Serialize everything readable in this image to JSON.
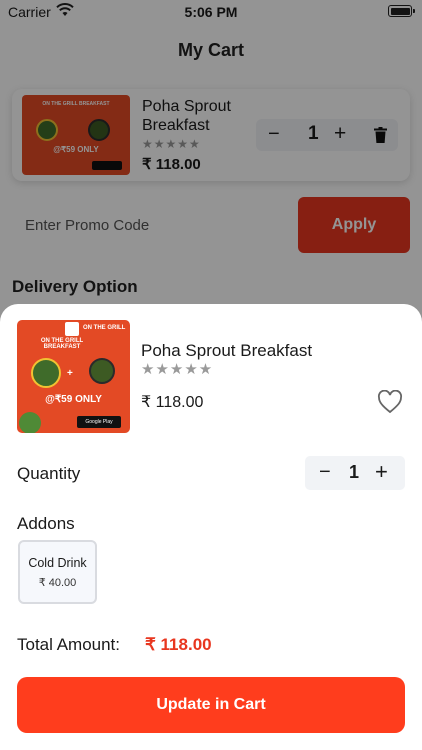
{
  "status_bar": {
    "carrier": "Carrier",
    "time": "5:06 PM"
  },
  "header": {
    "title": "My Cart"
  },
  "cart_item": {
    "name": "Poha  Sprout Breakfast",
    "rating_stars": "★★★★★",
    "price": "₹ 118.00",
    "quantity": "1",
    "minus": "−",
    "plus": "+"
  },
  "promo": {
    "placeholder": "Enter Promo Code",
    "apply_label": "Apply"
  },
  "delivery": {
    "title": "Delivery Option"
  },
  "banner": {
    "brand": "ON THE GRILL",
    "headline": "ON THE GRILL BREAKFAST",
    "offer": "@₹59 ONLY",
    "store_badge": "Google Play"
  },
  "sheet": {
    "name": "Poha  Sprout Breakfast",
    "rating_stars": "★★★★★",
    "price": "₹ 118.00",
    "quantity_label": "Quantity",
    "quantity": "1",
    "minus": "−",
    "plus": "+",
    "addons_label": "Addons",
    "addons": [
      {
        "name": "Cold Drink",
        "price": "₹ 40.00"
      }
    ],
    "total_label": "Total Amount:",
    "total_value": "₹ 118.00",
    "update_label": "Update in Cart"
  },
  "colors": {
    "accent": "#ff3d1d",
    "apply": "#e8361f",
    "price_red": "#e8361f",
    "stepper_bg": "#f1f3f6"
  }
}
